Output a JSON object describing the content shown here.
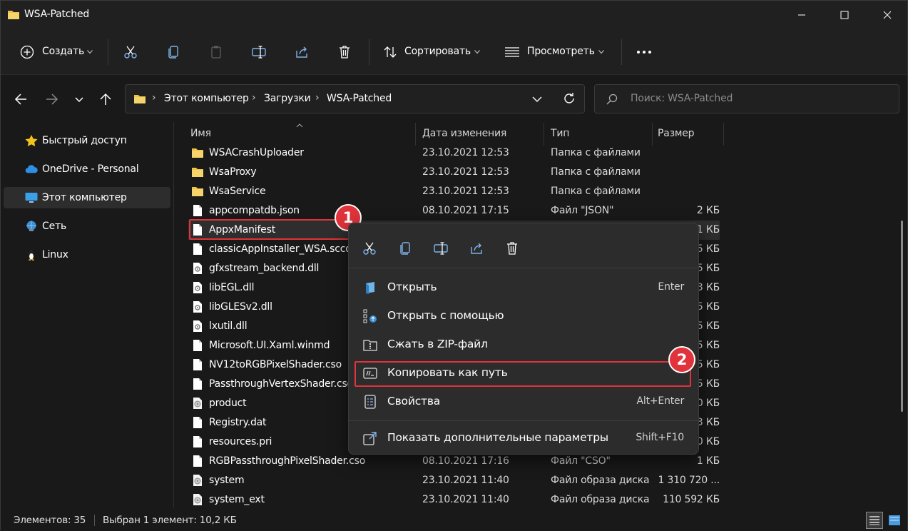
{
  "window": {
    "title": "WSA-Patched"
  },
  "toolbar": {
    "new_label": "Создать",
    "sort_label": "Сортировать",
    "view_label": "Просмотреть"
  },
  "address": {
    "crumbs": [
      "Этот компьютер",
      "Загрузки",
      "WSA-Patched"
    ]
  },
  "search": {
    "placeholder": "Поиск: WSA-Patched"
  },
  "nav": {
    "items": [
      {
        "label": "Быстрый доступ",
        "icon": "star-icon"
      },
      {
        "label": "OneDrive - Personal",
        "icon": "cloud-icon"
      },
      {
        "label": "Этот компьютер",
        "icon": "computer-icon",
        "selected": true
      },
      {
        "label": "Сеть",
        "icon": "network-icon"
      },
      {
        "label": "Linux",
        "icon": "penguin-icon"
      }
    ]
  },
  "columns": {
    "name": "Имя",
    "date": "Дата изменения",
    "type": "Тип",
    "size": "Размер"
  },
  "files": [
    {
      "name": "WSACrashUploader",
      "date": "23.10.2021 12:53",
      "type": "Папка с файлами",
      "size": "",
      "icon": "folder"
    },
    {
      "name": "WsaProxy",
      "date": "23.10.2021 12:53",
      "type": "Папка с файлами",
      "size": "",
      "icon": "folder"
    },
    {
      "name": "WsaService",
      "date": "23.10.2021 12:53",
      "type": "Папка с файлами",
      "size": "",
      "icon": "folder"
    },
    {
      "name": "appcompatdb.json",
      "date": "08.10.2021 17:15",
      "type": "Файл \"JSON\"",
      "size": "2 КБ",
      "icon": "file"
    },
    {
      "name": "AppxManifest",
      "date": "",
      "type": "",
      "size": "1 КБ",
      "icon": "file"
    },
    {
      "name": "classicAppInstaller_WSA.sccd",
      "date": "",
      "type": "",
      "size": "5 КБ",
      "icon": "file"
    },
    {
      "name": "gfxstream_backend.dll",
      "date": "",
      "type": "",
      "size": "5 КБ",
      "icon": "dll"
    },
    {
      "name": "libEGL.dll",
      "date": "",
      "type": "",
      "size": "3 КБ",
      "icon": "dll"
    },
    {
      "name": "libGLESv2.dll",
      "date": "",
      "type": "",
      "size": "5 КБ",
      "icon": "dll"
    },
    {
      "name": "lxutil.dll",
      "date": "",
      "type": "",
      "size": "5 КБ",
      "icon": "dll"
    },
    {
      "name": "Microsoft.UI.Xaml.winmd",
      "date": "",
      "type": "",
      "size": "5 КБ",
      "icon": "file"
    },
    {
      "name": "NV12toRGBPixelShader.cso",
      "date": "",
      "type": "",
      "size": "5 КБ",
      "icon": "file"
    },
    {
      "name": "PassthroughVertexShader.cso",
      "date": "",
      "type": "",
      "size": "5 КБ",
      "icon": "file"
    },
    {
      "name": "product",
      "date": "",
      "type": "",
      "size": "0 КБ",
      "icon": "disk"
    },
    {
      "name": "Registry.dat",
      "date": "",
      "type": "",
      "size": "3 КБ",
      "icon": "file"
    },
    {
      "name": "resources.pri",
      "date": "",
      "type": "",
      "size": "0 КБ",
      "icon": "file"
    },
    {
      "name": "RGBPassthroughPixelShader.cso",
      "date": "08.10.2021 17:16",
      "type": "Файл \"CSO\"",
      "size": "1 КБ",
      "icon": "file"
    },
    {
      "name": "system",
      "date": "23.10.2021 11:40",
      "type": "Файл образа диска",
      "size": "1 310 720 ...",
      "icon": "disk"
    },
    {
      "name": "system_ext",
      "date": "23.10.2021 11:40",
      "type": "Файл образа диска",
      "size": "110 592 КБ",
      "icon": "disk"
    }
  ],
  "context_menu": {
    "items": [
      {
        "label": "Открыть",
        "shortcut": "Enter"
      },
      {
        "label": "Открыть с помощью",
        "shortcut": ""
      },
      {
        "label": "Сжать в ZIP-файл",
        "shortcut": ""
      },
      {
        "label": "Копировать как путь",
        "shortcut": ""
      },
      {
        "label": "Свойства",
        "shortcut": "Alt+Enter"
      },
      {
        "label": "Показать дополнительные параметры",
        "shortcut": "Shift+F10"
      }
    ]
  },
  "annotations": {
    "badge1": "1",
    "badge2": "2"
  },
  "status": {
    "count": "Элементов: 35",
    "selected": "Выбран 1 элемент: 10,2 КБ"
  },
  "colors": {
    "accent": "#e0333b",
    "folder": "#f0c24a",
    "background": "#191919"
  }
}
